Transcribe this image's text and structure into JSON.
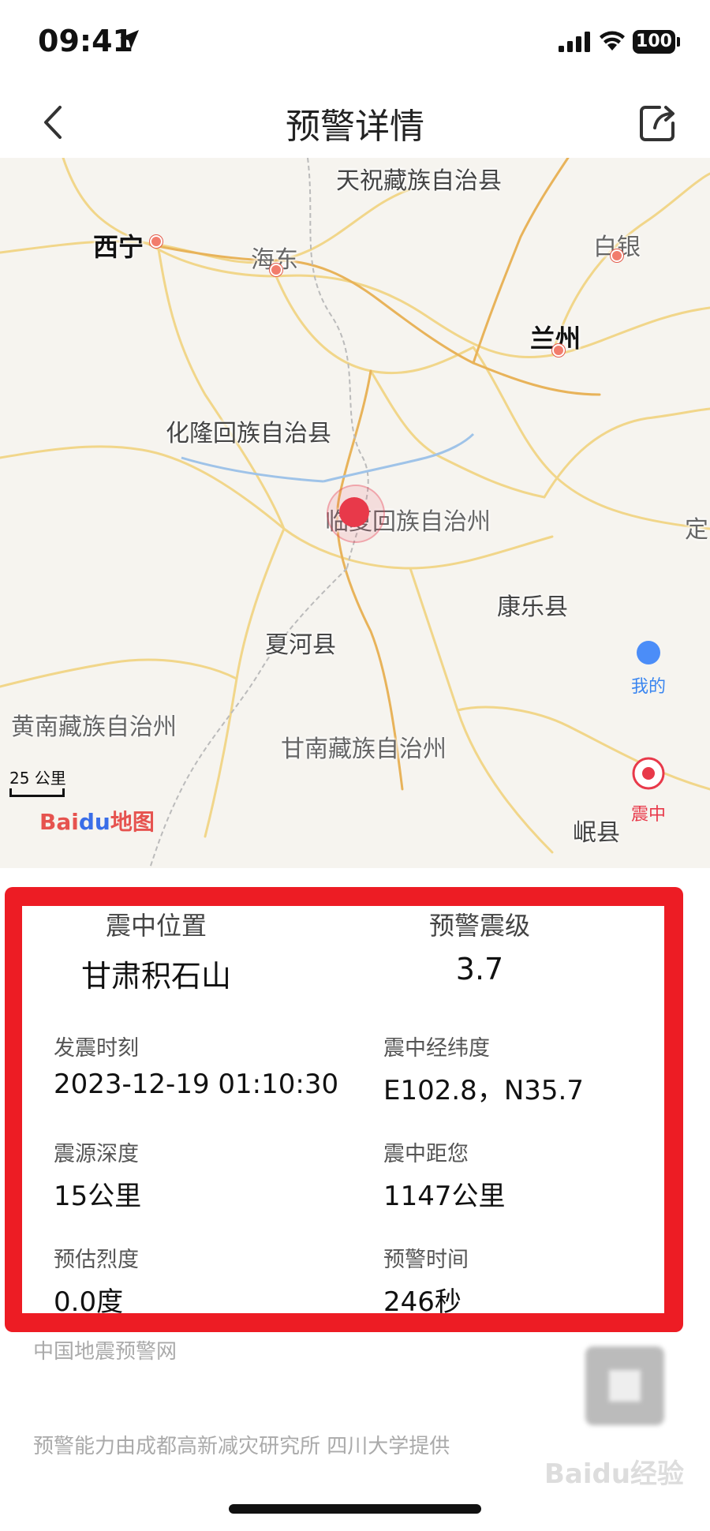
{
  "status_bar": {
    "time": "09:41",
    "battery": "100"
  },
  "header": {
    "title": "预警详情"
  },
  "map": {
    "places": {
      "tianzhu": "天祝藏族自治县",
      "xining": "西宁",
      "haidong": "海东",
      "baiyin": "白银",
      "lanzhou": "兰州",
      "hualong": "化隆回族自治县",
      "linxia": "临夏回族自治州",
      "ding": "定",
      "kangle": "康乐县",
      "xiahe": "夏河县",
      "huangnan": "黄南藏族自治州",
      "gannan": "甘南藏族自治州",
      "min": "岷县"
    },
    "scale_label": "25 公里",
    "logo": {
      "bai": "Bai",
      "du": "du",
      "map": "地图"
    },
    "controls": {
      "me_label": "我的",
      "epicenter_label": "震中"
    }
  },
  "info": {
    "epicenter_location": {
      "label": "震中位置",
      "value": "甘肃积石山"
    },
    "warning_magnitude": {
      "label": "预警震级",
      "value": "3.7"
    },
    "quake_time": {
      "label": "发震时刻",
      "value": "2023-12-19 01:10:30"
    },
    "coordinates": {
      "label": "震中经纬度",
      "value": "E102.8，N35.7"
    },
    "depth": {
      "label": "震源深度",
      "value": "15公里"
    },
    "distance": {
      "label": "震中距您",
      "value": "1147公里"
    },
    "intensity": {
      "label": "预估烈度",
      "value": "0.0度"
    },
    "warning_time": {
      "label": "预警时间",
      "value": "246秒"
    }
  },
  "footer": {
    "source": "中国地震预警网",
    "credit": "预警能力由成都高新减灾研究所 四川大学提供",
    "watermark": "Baidu经验"
  },
  "colors": {
    "accent_red": "#ed1c24",
    "quake_red": "#e8394a",
    "me_blue": "#3a86f0"
  }
}
